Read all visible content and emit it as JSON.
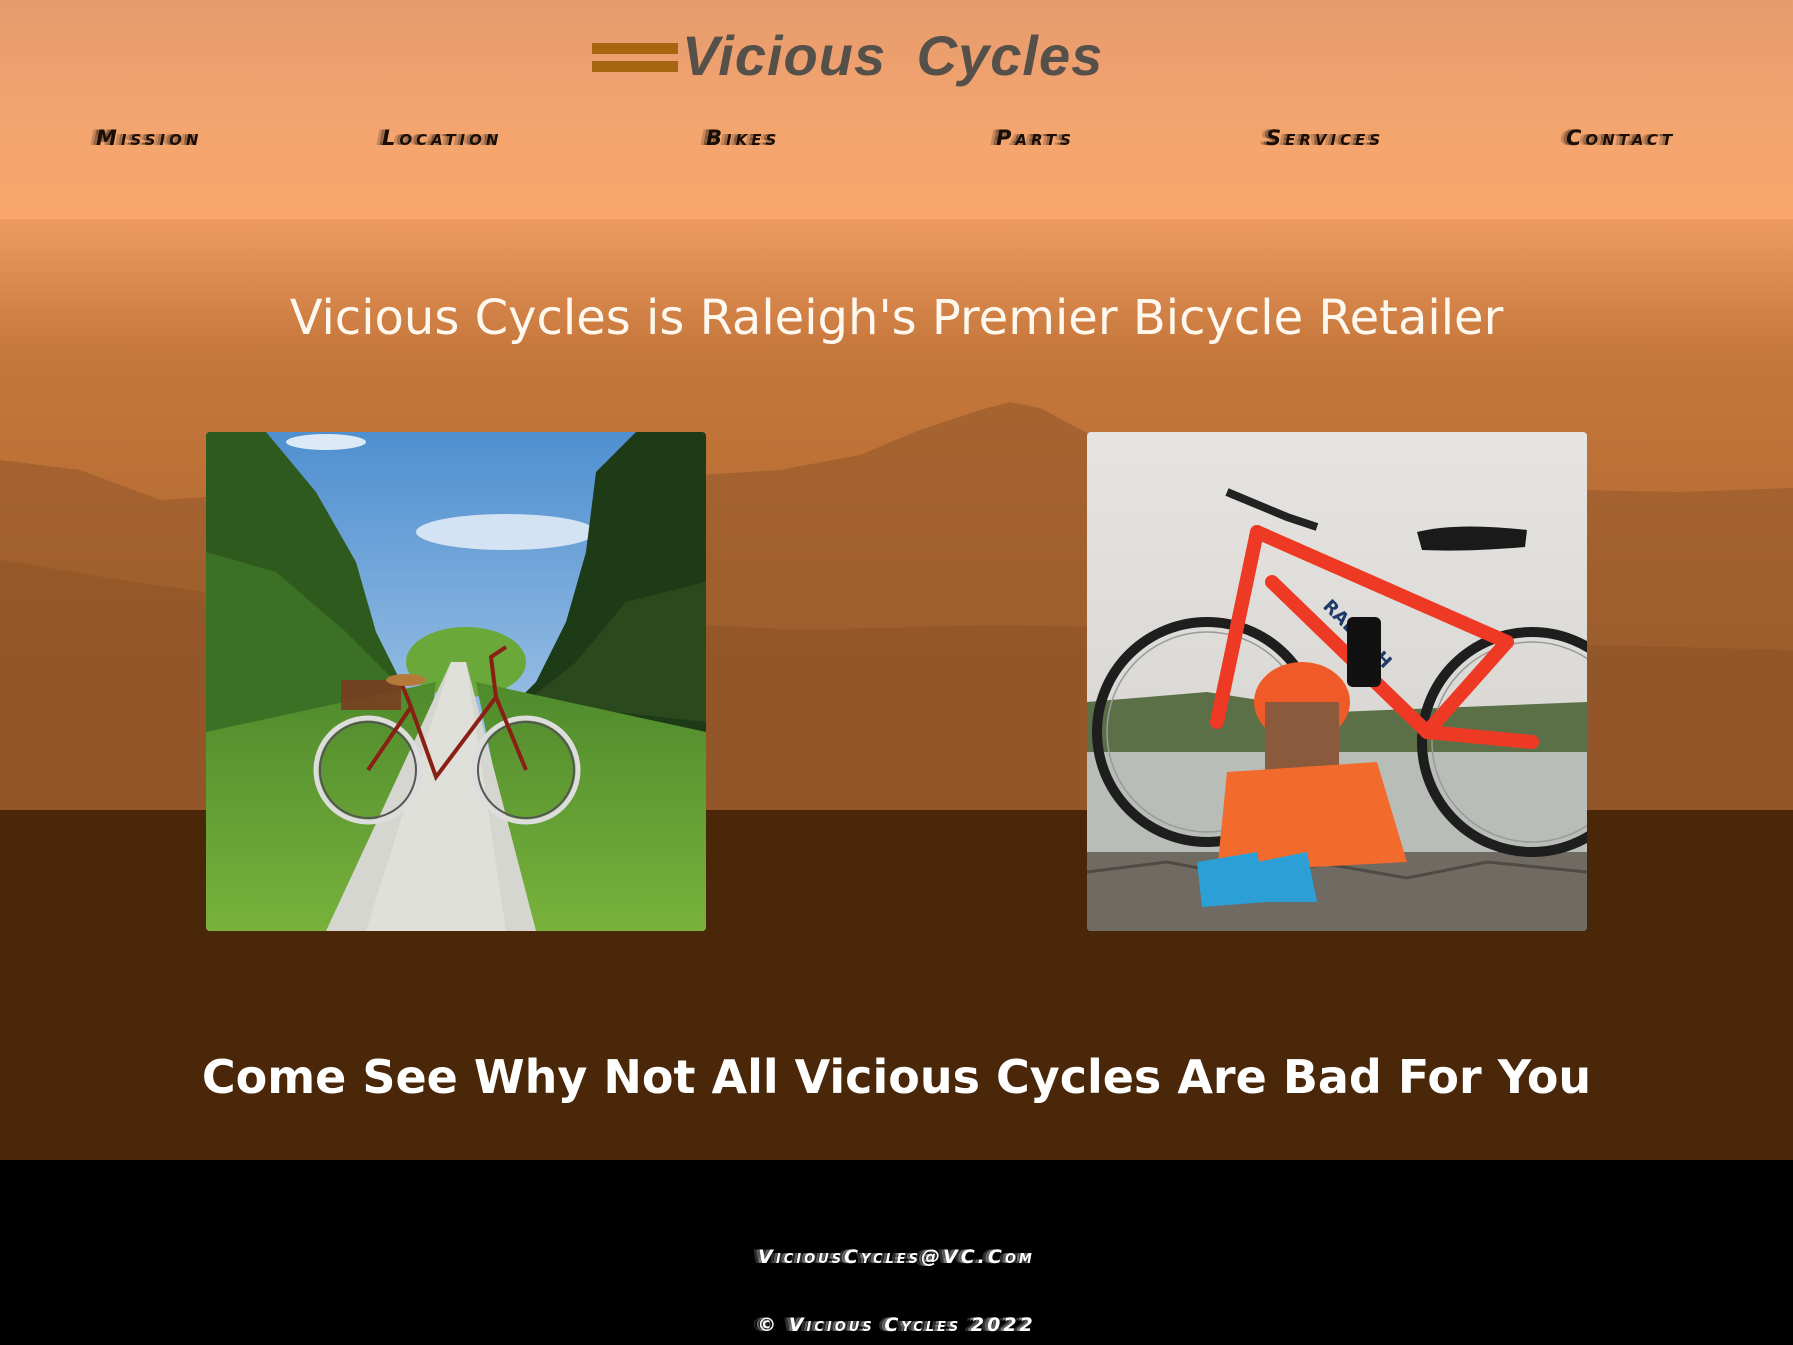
{
  "site": {
    "brand": "Vicious Cycles"
  },
  "nav": {
    "items": [
      {
        "label": "Mission"
      },
      {
        "label": "Location"
      },
      {
        "label": "Bikes"
      },
      {
        "label": "Parts"
      },
      {
        "label": "Services"
      },
      {
        "label": "Contact"
      }
    ]
  },
  "hero": {
    "headline": "Vicious Cycles is Raleigh's Premier Bicycle Retailer",
    "tagline": "Come See Why Not All Vicious Cycles Are Bad For You",
    "images": [
      {
        "subject": "red vintage bicycle on gravel path"
      },
      {
        "subject": "cyclist in orange helmet with red Raleigh bike",
        "frame_text": "RALEIGH"
      }
    ]
  },
  "footer": {
    "email": "ViciousCycles@VC.Com",
    "copyright": "© Vicious Cycles 2022"
  },
  "colors": {
    "header_bg": "#f4a56e",
    "logo_mark": "#a86510",
    "logo_text": "#555049",
    "ground": "#4a2709",
    "footer_bg": "#000000"
  }
}
